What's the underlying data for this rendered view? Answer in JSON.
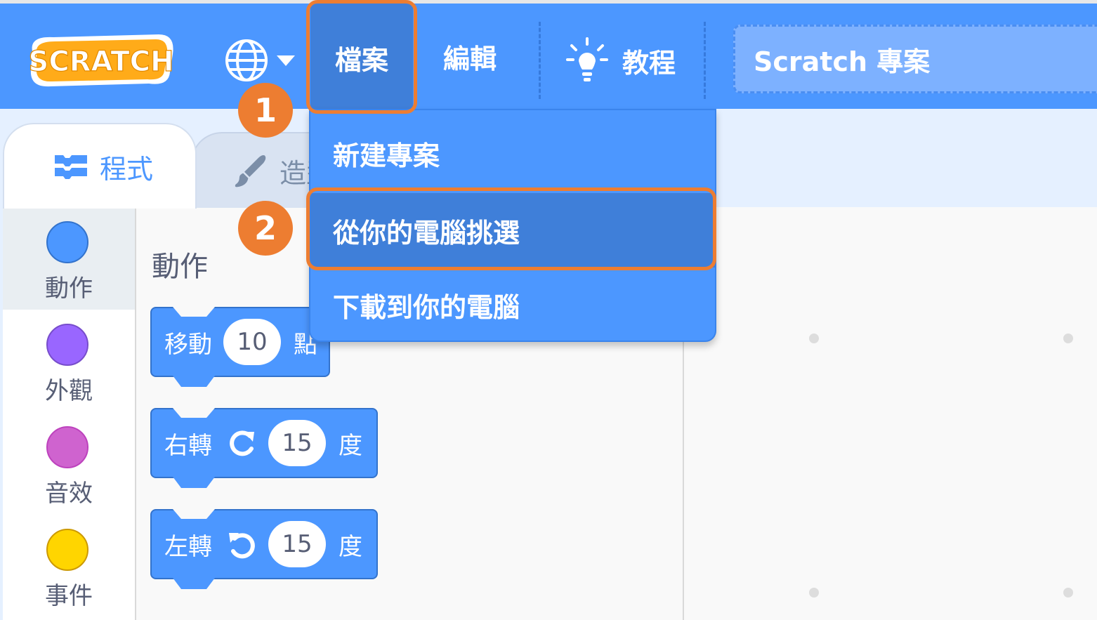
{
  "menubar": {
    "logo_text": "SCRATCH",
    "file_label": "檔案",
    "edit_label": "編輯",
    "tutorials_label": "教程",
    "project_title": "Scratch 專案"
  },
  "dropdown": {
    "items": [
      "新建專案",
      "從你的電腦挑選",
      "下載到你的電腦"
    ]
  },
  "steps": [
    "1",
    "2"
  ],
  "tabs": {
    "code_label": "程式",
    "costumes_label": "造型"
  },
  "categories": [
    {
      "label": "動作",
      "color": "#4c97ff"
    },
    {
      "label": "外觀",
      "color": "#9966ff"
    },
    {
      "label": "音效",
      "color": "#cf63cf"
    },
    {
      "label": "事件",
      "color": "#ffd500"
    }
  ],
  "flyout": {
    "title": "動作",
    "blocks": [
      {
        "label": "移動",
        "value": "10",
        "suffix": "點"
      },
      {
        "label": "右轉",
        "icon": "rotate-right-icon",
        "value": "15",
        "suffix": "度"
      },
      {
        "label": "左轉",
        "icon": "rotate-left-icon",
        "value": "15",
        "suffix": "度"
      }
    ]
  },
  "colors": {
    "accent": "#4c97ff",
    "highlight": "#ed7d31"
  }
}
